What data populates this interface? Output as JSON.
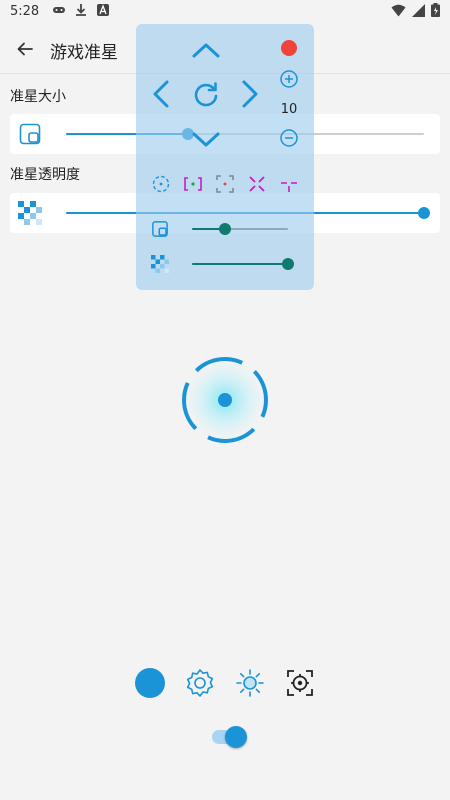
{
  "status_bar": {
    "time": "5:28"
  },
  "app_bar": {
    "title": "游戏准星"
  },
  "size_section": {
    "label": "准星大小",
    "value_fraction": 0.34
  },
  "opacity_section": {
    "label": "准星透明度",
    "value_fraction": 1.0
  },
  "overlay": {
    "step_value": "10",
    "size_value_fraction": 0.34,
    "opacity_value_fraction": 1.0
  },
  "colors": {
    "accent": "#1a94d6",
    "overlay_slider": "#117a6e",
    "close": "#f0433a"
  },
  "toggle": {
    "on": true
  }
}
